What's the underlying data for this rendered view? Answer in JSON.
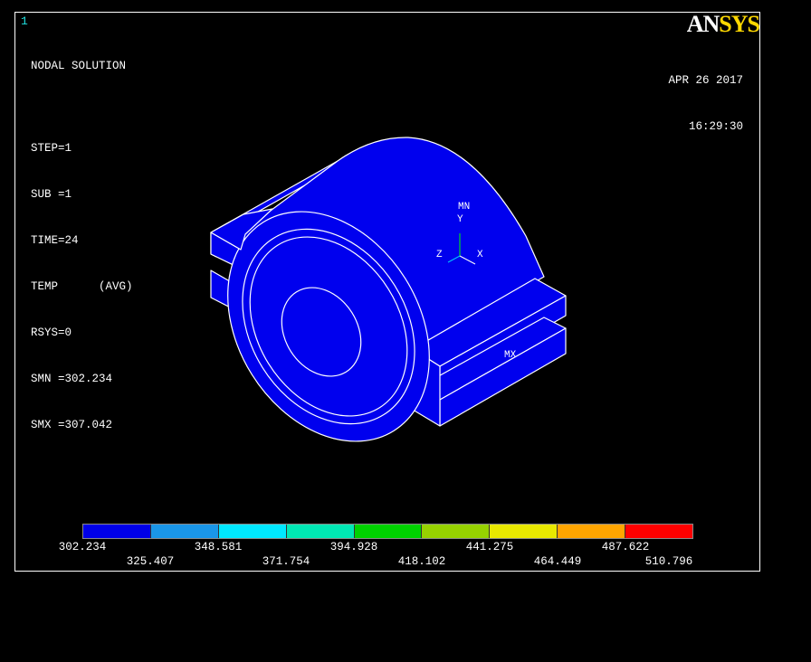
{
  "window_number": "1",
  "title": "NODAL SOLUTION",
  "info_lines": [
    "STEP=1",
    "SUB =1",
    "TIME=24",
    "TEMP      (AVG)",
    "RSYS=0",
    "SMN =302.234",
    "SMX =307.042"
  ],
  "logo": {
    "part1": "AN",
    "part2": "SYS"
  },
  "date": "APR 26 2017",
  "time": "16:29:30",
  "markers": {
    "min": "MN",
    "max": "MX"
  },
  "axes": {
    "x": "X",
    "y": "Y",
    "z": "Z"
  },
  "model_color": "#0000ee",
  "legend": {
    "colors": [
      "#0000e8",
      "#1a96e8",
      "#00e8ff",
      "#00e8b4",
      "#00d200",
      "#96d200",
      "#e8e800",
      "#ffa500",
      "#ff0000"
    ],
    "labels_top": [
      "302.234",
      "348.581",
      "394.928",
      "441.275",
      "487.622"
    ],
    "labels_bottom": [
      "325.407",
      "371.754",
      "418.102",
      "464.449",
      "510.796"
    ]
  }
}
